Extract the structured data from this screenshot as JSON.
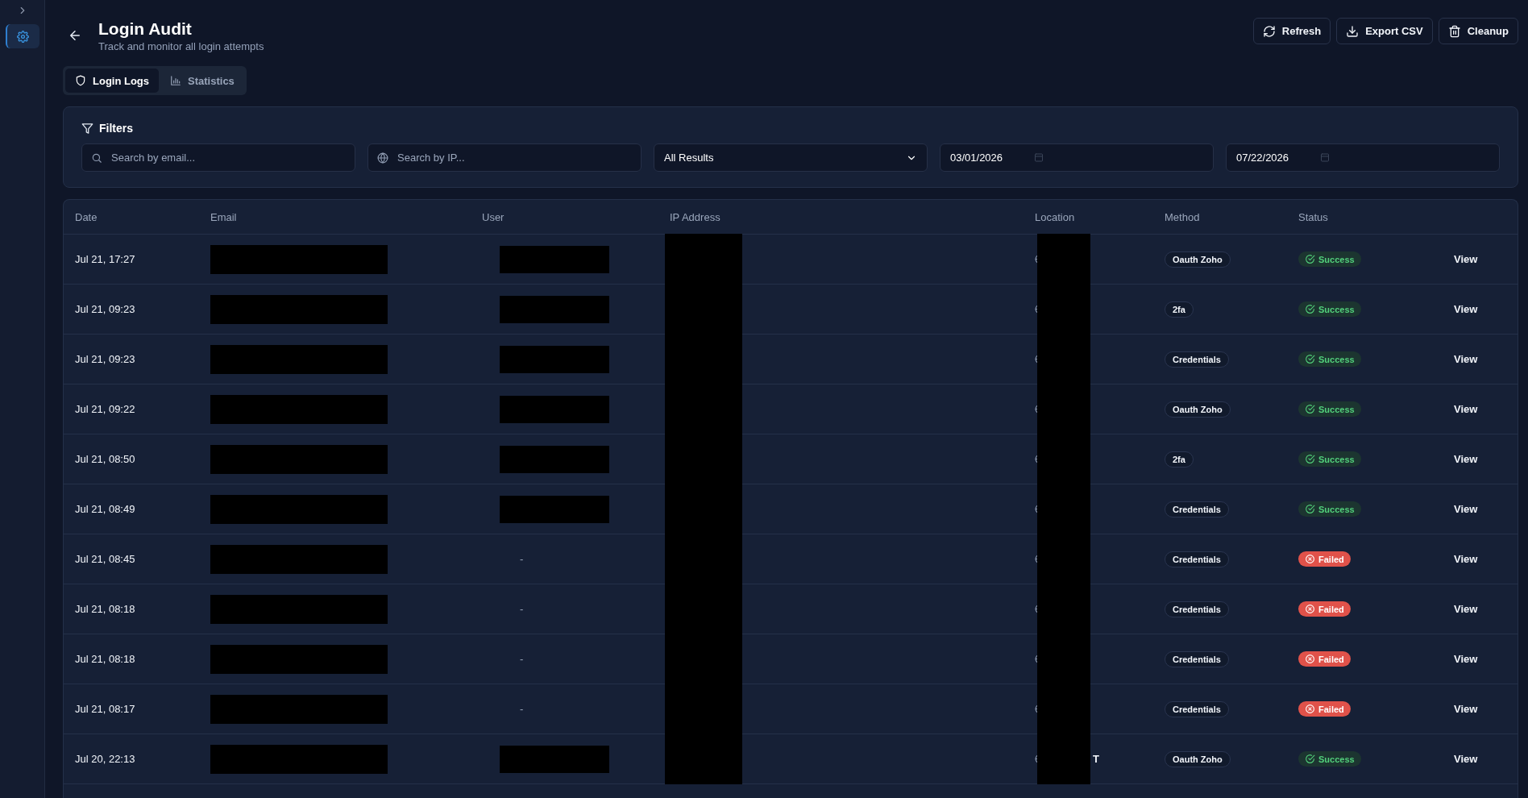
{
  "sidebar": {
    "items": [
      {
        "selected": true
      }
    ]
  },
  "header": {
    "title": "Login Audit",
    "subtitle": "Track and monitor all login attempts",
    "buttons": [
      {
        "label": "Refresh",
        "kind": "refresh"
      },
      {
        "label": "Export CSV",
        "kind": "download"
      },
      {
        "label": "Cleanup",
        "kind": "trash"
      }
    ]
  },
  "tabs": [
    {
      "label": "Login Logs",
      "kind": "shield",
      "selected": true
    },
    {
      "label": "Statistics",
      "kind": "chart",
      "selected": false
    }
  ],
  "filters": {
    "title": "Filters",
    "email_search": {
      "placeholder": "Search by email..."
    },
    "ip_search": {
      "placeholder": "Search by IP..."
    },
    "result_select": {
      "value": "All Results"
    },
    "date_from": {
      "value": "03/01/2026"
    },
    "date_to": {
      "value": "07/22/2026"
    }
  },
  "table": {
    "columns": [
      "Date",
      "Email",
      "User",
      "IP Address",
      "Location",
      "Method",
      "Status"
    ],
    "rows": [
      {
        "date": "Jul 21, 17:27",
        "email": {
          "redacted": true
        },
        "user": {
          "redacted": true
        },
        "ip": {
          "redacted": true
        },
        "location": {
          "redacted": true
        },
        "method": "Oauth Zoho",
        "status": {
          "label": "Success",
          "kind": "success"
        },
        "action": "View"
      },
      {
        "date": "Jul 21, 09:23",
        "email": {
          "redacted": true
        },
        "user": {
          "redacted": true
        },
        "ip": {
          "redacted": true
        },
        "location": {
          "redacted": true
        },
        "method": "2fa",
        "status": {
          "label": "Success",
          "kind": "success"
        },
        "action": "View"
      },
      {
        "date": "Jul 21, 09:23",
        "email": {
          "redacted": true
        },
        "user": {
          "redacted": true
        },
        "ip": {
          "redacted": true
        },
        "location": {
          "redacted": true
        },
        "method": "Credentials",
        "status": {
          "label": "Success",
          "kind": "success"
        },
        "action": "View"
      },
      {
        "date": "Jul 21, 09:22",
        "email": {
          "redacted": true
        },
        "user": {
          "redacted": true
        },
        "ip": {
          "redacted": true
        },
        "location": {
          "redacted": true
        },
        "method": "Oauth Zoho",
        "status": {
          "label": "Success",
          "kind": "success"
        },
        "action": "View"
      },
      {
        "date": "Jul 21, 08:50",
        "email": {
          "redacted": true
        },
        "user": {
          "redacted": true
        },
        "ip": {
          "redacted": true
        },
        "location": {
          "redacted": true
        },
        "method": "2fa",
        "status": {
          "label": "Success",
          "kind": "success"
        },
        "action": "View"
      },
      {
        "date": "Jul 21, 08:49",
        "email": {
          "redacted": true
        },
        "user": {
          "redacted": true
        },
        "ip": {
          "redacted": true
        },
        "location": {
          "redacted": true
        },
        "method": "Credentials",
        "status": {
          "label": "Success",
          "kind": "success"
        },
        "action": "View"
      },
      {
        "date": "Jul 21, 08:45",
        "email": {
          "redacted": true
        },
        "user": {
          "redacted": false,
          "text": "-"
        },
        "ip": {
          "redacted": true
        },
        "location": {
          "redacted": true
        },
        "method": "Credentials",
        "status": {
          "label": "Failed",
          "kind": "failed"
        },
        "action": "View"
      },
      {
        "date": "Jul 21, 08:18",
        "email": {
          "redacted": true
        },
        "user": {
          "redacted": false,
          "text": "-"
        },
        "ip": {
          "redacted": true
        },
        "location": {
          "redacted": true
        },
        "method": "Credentials",
        "status": {
          "label": "Failed",
          "kind": "failed"
        },
        "action": "View"
      },
      {
        "date": "Jul 21, 08:18",
        "email": {
          "redacted": true
        },
        "user": {
          "redacted": false,
          "text": "-"
        },
        "ip": {
          "redacted": true
        },
        "location": {
          "redacted": true
        },
        "method": "Credentials",
        "status": {
          "label": "Failed",
          "kind": "failed"
        },
        "action": "View"
      },
      {
        "date": "Jul 21, 08:17",
        "email": {
          "redacted": true
        },
        "user": {
          "redacted": false,
          "text": "-"
        },
        "ip": {
          "redacted": true
        },
        "location": {
          "redacted": true
        },
        "method": "Credentials",
        "status": {
          "label": "Failed",
          "kind": "failed"
        },
        "action": "View"
      },
      {
        "date": "Jul 20, 22:13",
        "email": {
          "redacted": true
        },
        "user": {
          "redacted": true
        },
        "ip": {
          "redacted": true
        },
        "location": {
          "redacted": true,
          "text": "T"
        },
        "method": "Oauth Zoho",
        "status": {
          "label": "Success",
          "kind": "success"
        },
        "action": "View"
      }
    ]
  }
}
